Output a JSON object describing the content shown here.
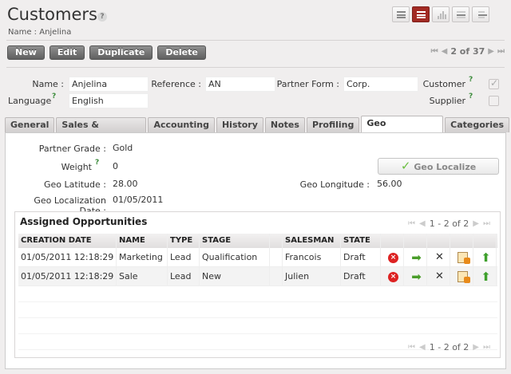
{
  "header": {
    "title": "Customers",
    "help": "?",
    "subtitle": "Name : Anjelina"
  },
  "toolbar": {
    "new_label": "New",
    "edit_label": "Edit",
    "duplicate_label": "Duplicate",
    "delete_label": "Delete"
  },
  "pager": {
    "text": "2 of 37"
  },
  "view_switch": [
    "list-view-icon",
    "form-view-icon",
    "graph-view-icon",
    "calendar-view-icon",
    "gantt-view-icon"
  ],
  "form": {
    "name_label": "Name :",
    "name_value": "Anjelina",
    "reference_label": "Reference :",
    "reference_value": "AN",
    "partner_form_label": "Partner Form :",
    "partner_form_value": "Corp.",
    "customer_label": "Customer",
    "customer_checked": true,
    "language_label": "Language",
    "language_value": "English",
    "supplier_label": "Supplier",
    "supplier_checked": false,
    "help_mark": "?"
  },
  "tabs": [
    "General",
    "Sales & Purchases",
    "Accounting",
    "History",
    "Notes",
    "Profiling",
    "Geo Localization",
    "Categories"
  ],
  "active_tab": "Geo Localization",
  "geo": {
    "partner_grade_label": "Partner Grade :",
    "partner_grade_value": "Gold",
    "weight_label": "Weight",
    "weight_value": "0",
    "geo_latitude_label": "Geo Latitude :",
    "geo_latitude_value": "28.00",
    "geo_longitude_label": "Geo Longitude :",
    "geo_longitude_value": "56.00",
    "geo_date_label": "Geo Localization Date :",
    "geo_date_value": "01/05/2011",
    "geo_localize_label": "Geo Localize"
  },
  "opportunities": {
    "title": "Assigned Opportunities",
    "pager_text": "1 - 2 of 2",
    "columns": [
      "CREATION DATE",
      "NAME",
      "TYPE",
      "STAGE",
      "SALESMAN",
      "STATE"
    ],
    "rows": [
      [
        "01/05/2011 12:18:29",
        "Marketing",
        "Lead",
        "Qualification",
        "Francois",
        "Draft"
      ],
      [
        "01/05/2011 12:18:29",
        "Sale",
        "Lead",
        "New",
        "Julien",
        "Draft"
      ]
    ]
  },
  "colors": {
    "accent": "#a22a23",
    "background": "#f0eeee",
    "button_gradient_top": "#8f8f8f",
    "button_gradient_bottom": "#5f5f5f",
    "help_green": "#3a8a3a"
  }
}
